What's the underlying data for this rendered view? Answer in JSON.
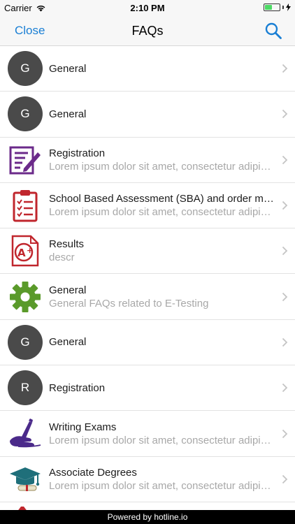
{
  "status_bar": {
    "carrier": "Carrier",
    "time": "2:10 PM",
    "battery_level": 0.5
  },
  "nav": {
    "close_label": "Close",
    "title": "FAQs",
    "search_icon": "search-icon"
  },
  "colors": {
    "accent": "#1a7fd4",
    "avatar": "#4a4a4a",
    "registration_purple": "#6b2a8a",
    "sba_red": "#c0262d",
    "gear_green": "#5a9a2a",
    "writing_purple": "#4b2a8a",
    "degree_teal": "#1f6f7a"
  },
  "faqs": [
    {
      "title": "General",
      "desc": "",
      "icon": "avatar-letter",
      "letter": "G"
    },
    {
      "title": "General",
      "desc": "",
      "icon": "avatar-letter",
      "letter": "G"
    },
    {
      "title": "Registration",
      "desc": "Lorem ipsum dolor sit amet, consectetur adipiscing elit",
      "icon": "registration-form-icon"
    },
    {
      "title": "School Based Assessment (SBA) and order merit",
      "desc": "Lorem ipsum dolor sit amet, consectetur adipiscing elit",
      "icon": "clipboard-checklist-icon"
    },
    {
      "title": "Results",
      "desc": "descr",
      "icon": "grade-a-plus-icon"
    },
    {
      "title": "General",
      "desc": "General FAQs related to E-Testing",
      "icon": "gear-icon"
    },
    {
      "title": "General",
      "desc": "",
      "icon": "avatar-letter",
      "letter": "G"
    },
    {
      "title": "Registration",
      "desc": "",
      "icon": "avatar-letter",
      "letter": "R"
    },
    {
      "title": "Writing Exams",
      "desc": "Lorem ipsum dolor sit amet, consectetur adipiscing elit",
      "icon": "hand-writing-icon"
    },
    {
      "title": "Associate Degrees",
      "desc": "Lorem ipsum dolor sit amet, consectetur adipiscing elit",
      "icon": "graduation-cap-icon"
    }
  ],
  "footer": {
    "text": "Powered by hotline.io"
  }
}
